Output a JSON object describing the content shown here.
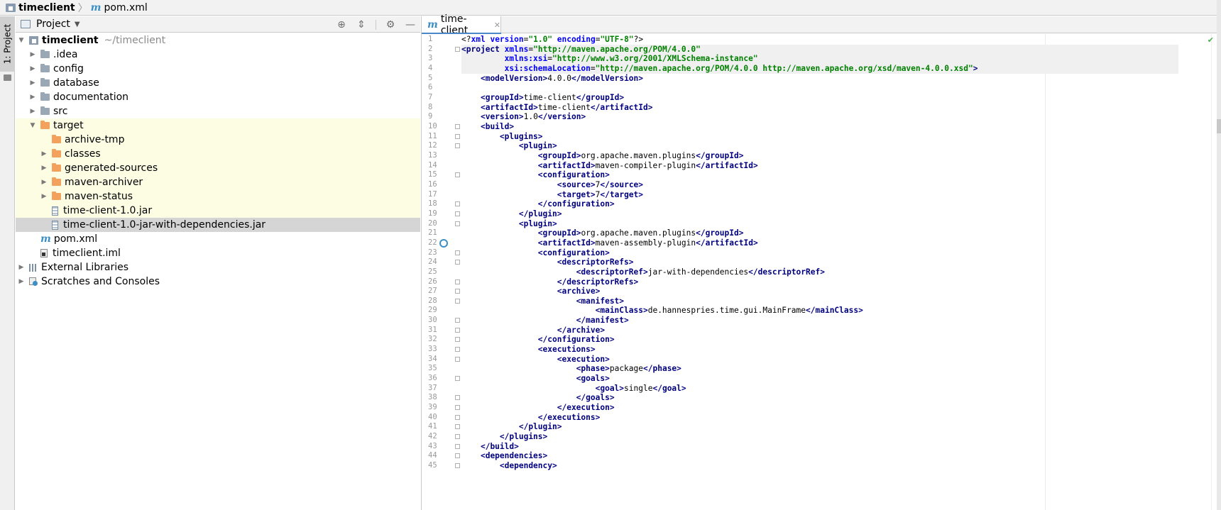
{
  "breadcrumb": {
    "project": "timeclient",
    "file": "pom.xml"
  },
  "sidebar_stripe": {
    "project_tab": "1: Project"
  },
  "project_panel": {
    "title": "Project",
    "tree": [
      {
        "label": "timeclient",
        "hint": "~/timeclient",
        "level": 0,
        "expanded": true,
        "icon": "project-root-icon"
      },
      {
        "label": ".idea",
        "level": 1,
        "expanded": false,
        "icon": "folder-icon"
      },
      {
        "label": "config",
        "level": 1,
        "expanded": false,
        "icon": "folder-icon"
      },
      {
        "label": "database",
        "level": 1,
        "expanded": false,
        "icon": "folder-icon"
      },
      {
        "label": "documentation",
        "level": 1,
        "expanded": false,
        "icon": "folder-icon"
      },
      {
        "label": "src",
        "level": 1,
        "expanded": false,
        "icon": "folder-icon"
      },
      {
        "label": "target",
        "level": 1,
        "expanded": true,
        "icon": "excluded-folder-icon"
      },
      {
        "label": "archive-tmp",
        "level": 2,
        "icon": "excluded-folder-icon"
      },
      {
        "label": "classes",
        "level": 2,
        "expanded": false,
        "icon": "excluded-folder-icon"
      },
      {
        "label": "generated-sources",
        "level": 2,
        "expanded": false,
        "icon": "excluded-folder-icon"
      },
      {
        "label": "maven-archiver",
        "level": 2,
        "expanded": false,
        "icon": "excluded-folder-icon"
      },
      {
        "label": "maven-status",
        "level": 2,
        "expanded": false,
        "icon": "excluded-folder-icon"
      },
      {
        "label": "time-client-1.0.jar",
        "level": 2,
        "icon": "jar-icon"
      },
      {
        "label": "time-client-1.0-jar-with-dependencies.jar",
        "level": 2,
        "icon": "jar-icon",
        "selected": true
      },
      {
        "label": "pom.xml",
        "level": 1,
        "icon": "maven-icon"
      },
      {
        "label": "timeclient.iml",
        "level": 1,
        "icon": "iml-icon"
      },
      {
        "label": "External Libraries",
        "level": 0,
        "expanded": false,
        "icon": "library-icon"
      },
      {
        "label": "Scratches and Consoles",
        "level": 0,
        "expanded": false,
        "icon": "scratches-icon"
      }
    ]
  },
  "editor": {
    "tab_label": "time-client",
    "line_numbers": [
      "1",
      "2",
      "3",
      "4",
      "5",
      "6",
      "7",
      "8",
      "9",
      "10",
      "11",
      "12",
      "13",
      "14",
      "15",
      "16",
      "17",
      "18",
      "19",
      "20",
      "21",
      "22",
      "23",
      "24",
      "25",
      "26",
      "27",
      "28",
      "29",
      "30",
      "31",
      "32",
      "33",
      "34",
      "35",
      "36",
      "37",
      "38",
      "39",
      "40",
      "41",
      "42",
      "43",
      "44",
      "45"
    ],
    "lines": [
      "<?xml version=\"1.0\" encoding=\"UTF-8\"?>",
      "<project xmlns=\"http://maven.apache.org/POM/4.0.0\"",
      "         xmlns:xsi=\"http://www.w3.org/2001/XMLSchema-instance\"",
      "         xsi:schemaLocation=\"http://maven.apache.org/POM/4.0.0 http://maven.apache.org/xsd/maven-4.0.0.xsd\">",
      "    <modelVersion>4.0.0</modelVersion>",
      "",
      "    <groupId>time-client</groupId>",
      "    <artifactId>time-client</artifactId>",
      "    <version>1.0</version>",
      "    <build>",
      "        <plugins>",
      "            <plugin>",
      "                <groupId>org.apache.maven.plugins</groupId>",
      "                <artifactId>maven-compiler-plugin</artifactId>",
      "                <configuration>",
      "                    <source>7</source>",
      "                    <target>7</target>",
      "                </configuration>",
      "            </plugin>",
      "            <plugin>",
      "                <groupId>org.apache.maven.plugins</groupId>",
      "                <artifactId>maven-assembly-plugin</artifactId>",
      "                <configuration>",
      "                    <descriptorRefs>",
      "                        <descriptorRef>jar-with-dependencies</descriptorRef>",
      "                    </descriptorRefs>",
      "                    <archive>",
      "                        <manifest>",
      "                            <mainClass>de.hannespries.time.gui.MainFrame</mainClass>",
      "                        </manifest>",
      "                    </archive>",
      "                </configuration>",
      "                <executions>",
      "                    <execution>",
      "                        <phase>package</phase>",
      "                        <goals>",
      "                            <goal>single</goal>",
      "                        </goals>",
      "                    </execution>",
      "                </executions>",
      "            </plugin>",
      "        </plugins>",
      "    </build>",
      "    <dependencies>",
      "        <dependency>"
    ],
    "fold_lines": [
      2,
      10,
      11,
      12,
      15,
      18,
      19,
      20,
      23,
      24,
      26,
      27,
      28,
      30,
      31,
      32,
      33,
      34,
      36,
      38,
      39,
      40,
      41,
      42,
      43,
      44,
      45
    ],
    "highlighted_lines": [
      2,
      3,
      4
    ],
    "gutter_marker_line": 22
  },
  "colors": {
    "tag": "#000080",
    "attribute": "#0000ff",
    "string": "#008000",
    "selection": "#d5d5d5",
    "excluded_folder": "#f3a25d",
    "excluded_bg": "#fdfde4"
  }
}
